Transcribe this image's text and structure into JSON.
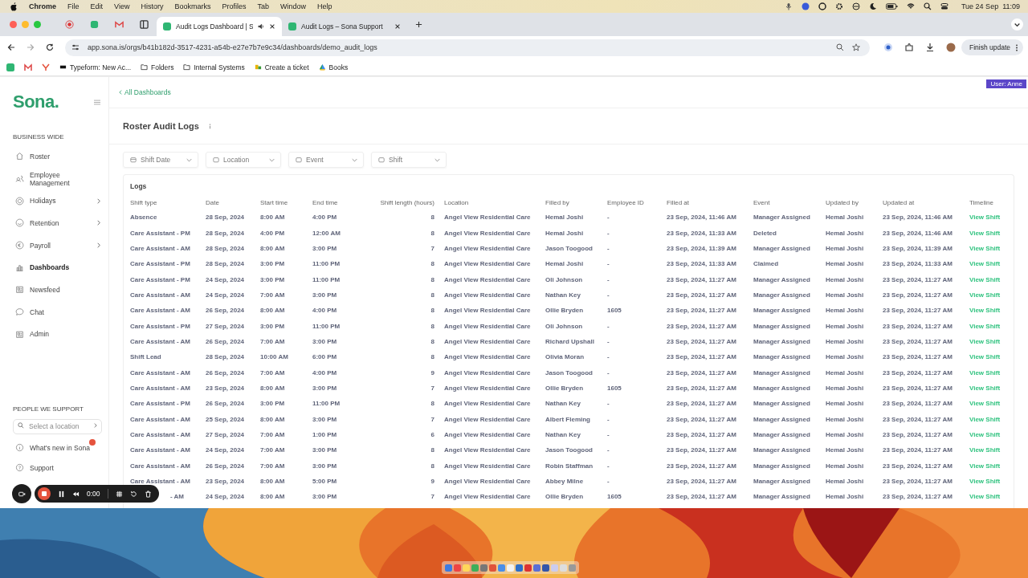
{
  "menu_bar": {
    "app": "Chrome",
    "menus": [
      "File",
      "Edit",
      "View",
      "History",
      "Bookmarks",
      "Profiles",
      "Tab",
      "Window",
      "Help"
    ],
    "clock": "Tue 24 Sep  11:09"
  },
  "browser": {
    "tabs": [
      {
        "title": "Audit Logs Dashboard | S",
        "selected": true
      },
      {
        "title": "Audit Logs – Sona Support",
        "selected": false
      }
    ],
    "url": "app.sona.is/orgs/b41b182d-3517-4231-a54b-e27e7b7e9c34/dashboards/demo_audit_logs",
    "update_button": "Finish update",
    "bookmarks": [
      {
        "label": "Typeform: New Ac...",
        "kind": "page"
      },
      {
        "label": "Folders",
        "kind": "folder"
      },
      {
        "label": "Internal Systems",
        "kind": "folder"
      },
      {
        "label": "Create a ticket",
        "kind": "ticket"
      },
      {
        "label": "Books",
        "kind": "drive"
      }
    ]
  },
  "sidebar": {
    "logo": "Sona.",
    "section": "BUSINESS WIDE",
    "items": [
      {
        "label": "Roster",
        "selected": false,
        "expandable": false
      },
      {
        "label": "Employee Management",
        "selected": false,
        "expandable": false
      },
      {
        "label": "Holidays",
        "selected": false,
        "expandable": true
      },
      {
        "label": "Retention",
        "selected": false,
        "expandable": true
      },
      {
        "label": "Payroll",
        "selected": false,
        "expandable": true
      },
      {
        "label": "Dashboards",
        "selected": true,
        "expandable": false
      },
      {
        "label": "Newsfeed",
        "selected": false,
        "expandable": false
      },
      {
        "label": "Chat",
        "selected": false,
        "expandable": false
      },
      {
        "label": "Admin",
        "selected": false,
        "expandable": false
      }
    ],
    "support_section": "PEOPLE WE SUPPORT",
    "location_search": {
      "placeholder": "Select a location"
    },
    "footer_items": [
      {
        "label": "What's new in Sona",
        "badge": true
      },
      {
        "label": "Support",
        "badge": false
      }
    ]
  },
  "user_badge": "User: Anne",
  "back_link": "All Dashboards",
  "title": "Roster Audit Logs",
  "filters": [
    "Shift Date",
    "Location",
    "Event",
    "Shift"
  ],
  "logs": {
    "title": "Logs",
    "columns": [
      "Shift type",
      "Date",
      "Start time",
      "End time",
      "Shift length (hours)",
      "Location",
      "Filled by",
      "Employee ID",
      "Filled at",
      "Event",
      "Updated by",
      "Updated at",
      "Timeline"
    ],
    "rows": [
      [
        "Absence",
        "28 Sep, 2024",
        "8:00 AM",
        "4:00 PM",
        "8",
        "Angel View Residential Care",
        "Hemal Joshi",
        "-",
        "23 Sep, 2024, 11:46 AM",
        "Manager Assigned",
        "Hemal Joshi",
        "23 Sep, 2024, 11:46 AM",
        "View Shift"
      ],
      [
        "Care Assistant - PM",
        "28 Sep, 2024",
        "4:00 PM",
        "12:00 AM",
        "8",
        "Angel View Residential Care",
        "Hemal Joshi",
        "-",
        "23 Sep, 2024, 11:33 AM",
        "Deleted",
        "Hemal Joshi",
        "23 Sep, 2024, 11:46 AM",
        "View Shift"
      ],
      [
        "Care Assistant - AM",
        "28 Sep, 2024",
        "8:00 AM",
        "3:00 PM",
        "7",
        "Angel View Residential Care",
        "Jason Toogood",
        "-",
        "23 Sep, 2024, 11:39 AM",
        "Manager Assigned",
        "Hemal Joshi",
        "23 Sep, 2024, 11:39 AM",
        "View Shift"
      ],
      [
        "Care Assistant - PM",
        "28 Sep, 2024",
        "3:00 PM",
        "11:00 PM",
        "8",
        "Angel View Residential Care",
        "Hemal Joshi",
        "-",
        "23 Sep, 2024, 11:33 AM",
        "Claimed",
        "Hemal Joshi",
        "23 Sep, 2024, 11:33 AM",
        "View Shift"
      ],
      [
        "Care Assistant - PM",
        "24 Sep, 2024",
        "3:00 PM",
        "11:00 PM",
        "8",
        "Angel View Residential Care",
        "Oli Johnson",
        "-",
        "23 Sep, 2024, 11:27 AM",
        "Manager Assigned",
        "Hemal Joshi",
        "23 Sep, 2024, 11:27 AM",
        "View Shift"
      ],
      [
        "Care Assistant - AM",
        "24 Sep, 2024",
        "7:00 AM",
        "3:00 PM",
        "8",
        "Angel View Residential Care",
        "Nathan Key",
        "-",
        "23 Sep, 2024, 11:27 AM",
        "Manager Assigned",
        "Hemal Joshi",
        "23 Sep, 2024, 11:27 AM",
        "View Shift"
      ],
      [
        "Care Assistant - AM",
        "26 Sep, 2024",
        "8:00 AM",
        "4:00 PM",
        "8",
        "Angel View Residential Care",
        "Ollie Bryden",
        "1605",
        "23 Sep, 2024, 11:27 AM",
        "Manager Assigned",
        "Hemal Joshi",
        "23 Sep, 2024, 11:27 AM",
        "View Shift"
      ],
      [
        "Care Assistant - PM",
        "27 Sep, 2024",
        "3:00 PM",
        "11:00 PM",
        "8",
        "Angel View Residential Care",
        "Oli Johnson",
        "-",
        "23 Sep, 2024, 11:27 AM",
        "Manager Assigned",
        "Hemal Joshi",
        "23 Sep, 2024, 11:27 AM",
        "View Shift"
      ],
      [
        "Care Assistant - AM",
        "26 Sep, 2024",
        "7:00 AM",
        "3:00 PM",
        "8",
        "Angel View Residential Care",
        "Richard Upshall",
        "-",
        "23 Sep, 2024, 11:27 AM",
        "Manager Assigned",
        "Hemal Joshi",
        "23 Sep, 2024, 11:27 AM",
        "View Shift"
      ],
      [
        "Shift Lead",
        "28 Sep, 2024",
        "10:00 AM",
        "6:00 PM",
        "8",
        "Angel View Residential Care",
        "Olivia Moran",
        "-",
        "23 Sep, 2024, 11:27 AM",
        "Manager Assigned",
        "Hemal Joshi",
        "23 Sep, 2024, 11:27 AM",
        "View Shift"
      ],
      [
        "Care Assistant - AM",
        "26 Sep, 2024",
        "7:00 AM",
        "4:00 PM",
        "9",
        "Angel View Residential Care",
        "Jason Toogood",
        "-",
        "23 Sep, 2024, 11:27 AM",
        "Manager Assigned",
        "Hemal Joshi",
        "23 Sep, 2024, 11:27 AM",
        "View Shift"
      ],
      [
        "Care Assistant - AM",
        "23 Sep, 2024",
        "8:00 AM",
        "3:00 PM",
        "7",
        "Angel View Residential Care",
        "Ollie Bryden",
        "1605",
        "23 Sep, 2024, 11:27 AM",
        "Manager Assigned",
        "Hemal Joshi",
        "23 Sep, 2024, 11:27 AM",
        "View Shift"
      ],
      [
        "Care Assistant - PM",
        "26 Sep, 2024",
        "3:00 PM",
        "11:00 PM",
        "8",
        "Angel View Residential Care",
        "Nathan Key",
        "-",
        "23 Sep, 2024, 11:27 AM",
        "Manager Assigned",
        "Hemal Joshi",
        "23 Sep, 2024, 11:27 AM",
        "View Shift"
      ],
      [
        "Care Assistant - AM",
        "25 Sep, 2024",
        "8:00 AM",
        "3:00 PM",
        "7",
        "Angel View Residential Care",
        "Albert Fleming",
        "-",
        "23 Sep, 2024, 11:27 AM",
        "Manager Assigned",
        "Hemal Joshi",
        "23 Sep, 2024, 11:27 AM",
        "View Shift"
      ],
      [
        "Care Assistant - AM",
        "27 Sep, 2024",
        "7:00 AM",
        "1:00 PM",
        "6",
        "Angel View Residential Care",
        "Nathan Key",
        "-",
        "23 Sep, 2024, 11:27 AM",
        "Manager Assigned",
        "Hemal Joshi",
        "23 Sep, 2024, 11:27 AM",
        "View Shift"
      ],
      [
        "Care Assistant - AM",
        "24 Sep, 2024",
        "7:00 AM",
        "3:00 PM",
        "8",
        "Angel View Residential Care",
        "Jason Toogood",
        "-",
        "23 Sep, 2024, 11:27 AM",
        "Manager Assigned",
        "Hemal Joshi",
        "23 Sep, 2024, 11:27 AM",
        "View Shift"
      ],
      [
        "Care Assistant - AM",
        "26 Sep, 2024",
        "7:00 AM",
        "3:00 PM",
        "8",
        "Angel View Residential Care",
        "Robin Staffman",
        "-",
        "23 Sep, 2024, 11:27 AM",
        "Manager Assigned",
        "Hemal Joshi",
        "23 Sep, 2024, 11:27 AM",
        "View Shift"
      ],
      [
        "Care Assistant - AM",
        "23 Sep, 2024",
        "8:00 AM",
        "5:00 PM",
        "9",
        "Angel View Residential Care",
        "Abbey Milne",
        "-",
        "23 Sep, 2024, 11:27 AM",
        "Manager Assigned",
        "Hemal Joshi",
        "23 Sep, 2024, 11:27 AM",
        "View Shift"
      ],
      [
        "- AM",
        "24 Sep, 2024",
        "8:00 AM",
        "3:00 PM",
        "7",
        "Angel View Residential Care",
        "Ollie Bryden",
        "1605",
        "23 Sep, 2024, 11:27 AM",
        "Manager Assigned",
        "Hemal Joshi",
        "23 Sep, 2024, 11:27 AM",
        "View Shift"
      ]
    ]
  },
  "recorder": {
    "timer": "0:00"
  }
}
